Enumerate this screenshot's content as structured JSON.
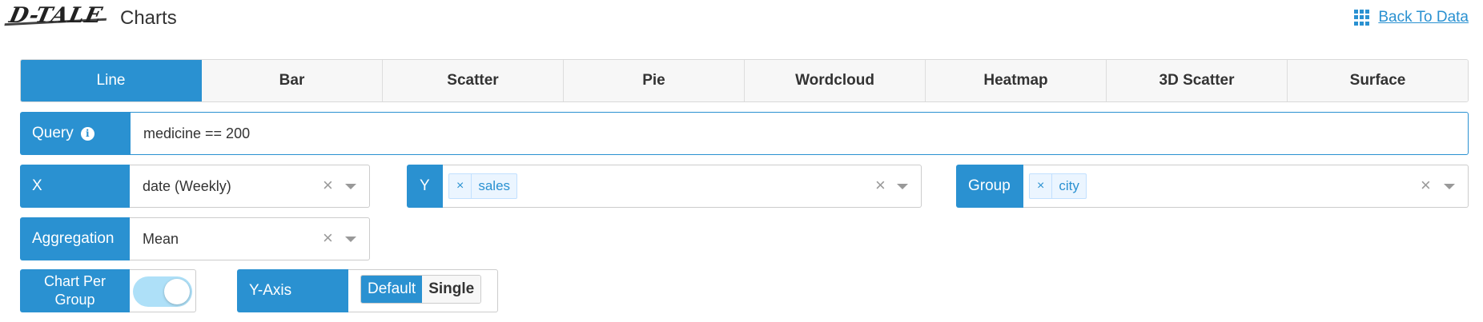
{
  "header": {
    "logo_text": "D-TALE",
    "title": "Charts",
    "back_link": "Back To Data",
    "back_icon": "grid-icon"
  },
  "tabs": [
    {
      "label": "Line",
      "active": true
    },
    {
      "label": "Bar",
      "active": false
    },
    {
      "label": "Scatter",
      "active": false
    },
    {
      "label": "Pie",
      "active": false
    },
    {
      "label": "Wordcloud",
      "active": false
    },
    {
      "label": "Heatmap",
      "active": false
    },
    {
      "label": "3D Scatter",
      "active": false
    },
    {
      "label": "Surface",
      "active": false
    }
  ],
  "query": {
    "label": "Query",
    "value": "medicine == 200",
    "info_icon": "info-icon"
  },
  "x": {
    "label": "X",
    "value": "date (Weekly)"
  },
  "y": {
    "label": "Y",
    "chips": [
      "sales"
    ]
  },
  "group": {
    "label": "Group",
    "chips": [
      "city"
    ]
  },
  "aggregation": {
    "label": "Aggregation",
    "value": "Mean"
  },
  "chart_per_group": {
    "label_line1": "Chart Per",
    "label_line2": "Group",
    "enabled": true
  },
  "y_axis": {
    "label": "Y-Axis",
    "options": [
      "Default",
      "Single"
    ],
    "selected": "Default"
  },
  "colors": {
    "accent": "#2a91d1",
    "chip_bg": "#ebf5ff",
    "toggle_track": "#aee0f8"
  }
}
